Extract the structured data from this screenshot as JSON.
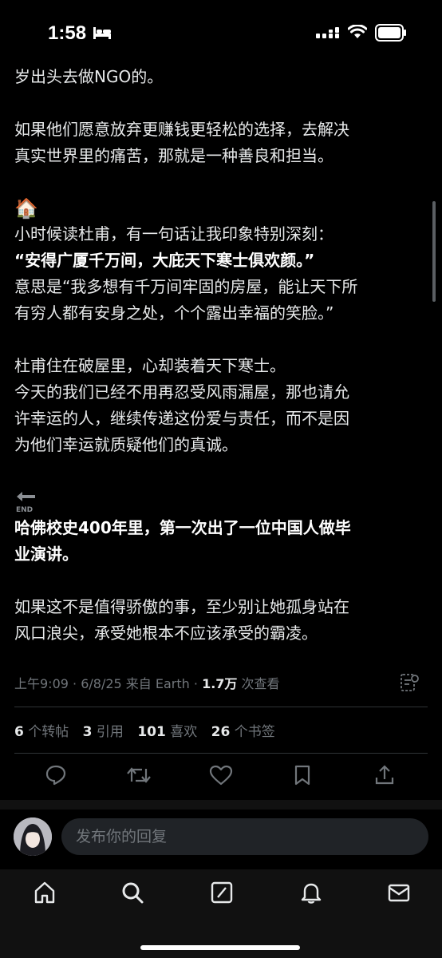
{
  "status_bar": {
    "time": "1:58"
  },
  "post": {
    "lines_top": [
      "岁出头去做NGO的。"
    ],
    "para1": [
      "如果他们愿意放弃更赚钱更轻松的选择，去解决",
      "真实世界里的痛苦，那就是一种善良和担当。"
    ],
    "house_emoji": "🏠",
    "para2_intro": "小时候读杜甫，有一句话让我印象特别深刻：",
    "quote": "“安得广厦千万间，大庇天下寒士俱欢颜。”",
    "para2_rest": [
      "意思是“我多想有千万间牢固的房屋，能让天下所",
      "有穷人都有安身之处，个个露出幸福的笑脸。”"
    ],
    "para3": [
      "杜甫住在破屋里，心却装着天下寒士。",
      "今天的我们已经不用再忍受风雨漏屋，那也请允",
      "许幸运的人，继续传递这份爱与责任，而不是因",
      "为他们幸运就质疑他们的真诚。"
    ],
    "end_label": "END",
    "highlight": [
      "哈佛校史400年里，第一次出了一位中国人做毕",
      "业演讲。"
    ],
    "para4": [
      "如果这不是值得骄傲的事，至少别让她孤身站在",
      "风口浪尖，承受她根本不应该承受的霸凌。"
    ]
  },
  "meta": {
    "time": "上午9:09",
    "date": "6/8/25",
    "source": "来自 Earth",
    "views": "1.7万",
    "views_label": "次查看"
  },
  "stats": {
    "reposts": "6",
    "reposts_label": "个转帖",
    "quotes": "3",
    "quotes_label": "引用",
    "likes": "101",
    "likes_label": "喜欢",
    "bookmarks": "26",
    "bookmarks_label": "个书签"
  },
  "actions": {
    "icons": [
      "reply-icon",
      "repost-icon",
      "like-icon",
      "bookmark-icon",
      "share-icon"
    ]
  },
  "reply": {
    "placeholder": "发布你的回复"
  },
  "tabbar": {
    "icons": [
      "home-icon",
      "search-icon",
      "grok-icon",
      "notifications-icon",
      "messages-icon"
    ]
  }
}
